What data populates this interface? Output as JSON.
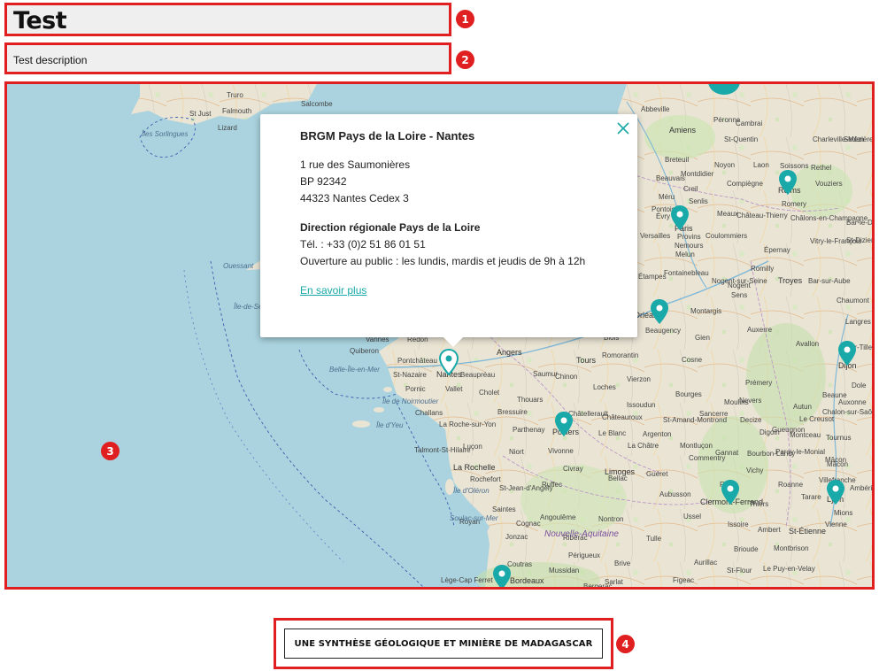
{
  "page": {
    "title": "Test",
    "description": "Test description"
  },
  "annotations": [
    "1",
    "2",
    "3",
    "4"
  ],
  "map": {
    "pin_color": "#1aa9a9",
    "sea_color": "#aad3df",
    "land_color": "#e9e4d4",
    "labels": [
      "Truro",
      "Falmouth",
      "St Just",
      "Lizard",
      "Salcombe",
      "Îles Sorlingues",
      "Ouessant",
      "Île-de-Sein",
      "Vannes",
      "Redon",
      "Quiberon",
      "Pontchâteau",
      "Belle-Île-en-Mer",
      "St-Nazaire",
      "Pornic",
      "Île de Noirmoutier",
      "Challans",
      "Île d'Yeu",
      "Nantes",
      "Vallet",
      "Angers",
      "Beaupréau",
      "Cholet",
      "Bressuire",
      "Thouars",
      "Tours",
      "Saumur",
      "Chinon",
      "Loches",
      "Parthenay",
      "La Roche-sur-Yon",
      "Luçon",
      "Talmont-St-Hilaire",
      "La Rochelle",
      "Île d'Oléron",
      "Rochefort",
      "Saintes",
      "St-Jean-d'Angély",
      "Niort",
      "Poitiers",
      "Châtellerault",
      "Le Blanc",
      "Vivonne",
      "Civray",
      "Ruffec",
      "Angoulême",
      "Cognac",
      "Jonzac",
      "Royan",
      "Soulac-sur-Mer",
      "Coutras",
      "Bordeaux",
      "Lège-Cap Ferret",
      "Bergerac",
      "Périgueux",
      "Mussidan",
      "Ribérac",
      "Nontron",
      "Limoges",
      "Bellac",
      "Guéret",
      "Aubusson",
      "Ussel",
      "Tulle",
      "Brive",
      "Sarlat",
      "Figeac",
      "Aurillac",
      "Clermont-Ferrand",
      "Riom",
      "Thiers",
      "Ambert",
      "Issoire",
      "Brioude",
      "Le Puy-en-Velay",
      "St-Flour",
      "St-Étienne",
      "Lyon",
      "Vienne",
      "Mions",
      "Villefranche",
      "Mâcon",
      "Tournus",
      "Chalon-sur-Saône",
      "Beaune",
      "Dijon",
      "Dole",
      "Auxonne",
      "Is-sur-Tille",
      "Langres",
      "Chaumont",
      "Troyes",
      "Bar-sur-Aube",
      "Nogent",
      "Provins",
      "Melun",
      "Fontainebleau",
      "Sens",
      "Auxerre",
      "Avallon",
      "Nevers",
      "Cosne",
      "Bourges",
      "Vierzon",
      "Romorantin",
      "Blois",
      "Orléans",
      "Beaugency",
      "Gien",
      "Montargis",
      "Nemours",
      "Étampes",
      "Évry",
      "Paris",
      "Versailles",
      "Pontoise",
      "Senlis",
      "Compiègne",
      "Beauvais",
      "Méru",
      "Creil",
      "Coulommiers",
      "Meaux",
      "Château-Thierry",
      "Épernay",
      "Châlons-en-Champagne",
      "Reims",
      "Rethel",
      "Sedan",
      "Charleville-Mézières",
      "Laon",
      "Soissons",
      "Noyon",
      "St-Quentin",
      "Péronne",
      "Amiens",
      "Abbeville",
      "Cambrai",
      "Breteuil",
      "Montdidier",
      "Vitry-le-François",
      "St-Dizier",
      "Bar-le-Duc",
      "Vouziers",
      "Romery",
      "Romilly",
      "Nogent-sur-Seine",
      "Bourbon-Lancy",
      "Digoin",
      "Moulins",
      "Montluçon",
      "Vichy",
      "Gannat",
      "Commentry",
      "La Châtre",
      "Châteauroux",
      "Issoudun",
      "Argenton",
      "St-Amand-Montrond",
      "Sancerre",
      "Prémery",
      "Decize",
      "Gueugnon",
      "Paray-le-Monial",
      "Roanne",
      "Tarare",
      "Montbrison",
      "Ambérieu",
      "Mâcon",
      "Autun",
      "Le Creusot",
      "Montceau",
      "Nouvelle-Aquitaine"
    ],
    "pins": [
      "Nantes",
      "Orléans",
      "Paris",
      "Reims",
      "Dijon",
      "Poitiers",
      "Clermont-Ferrand",
      "Lyon",
      "Bordeaux"
    ]
  },
  "popup": {
    "title": "BRGM Pays de la Loire - Nantes",
    "address_line1": "1 rue des Saumonières",
    "address_line2": "BP 92342",
    "address_line3": "44323 Nantes Cedex 3",
    "section_title": "Direction régionale Pays de la Loire",
    "phone": "Tél. : +33 (0)2 51 86 01 51",
    "hours": "Ouverture au public : les lundis, mardis et jeudis de 9h à 12h",
    "link_label": "En savoir plus"
  },
  "cta": {
    "label": "UNE SYNTHÈSE GÉOLOGIQUE ET MINIÈRE DE MADAGASCAR"
  }
}
